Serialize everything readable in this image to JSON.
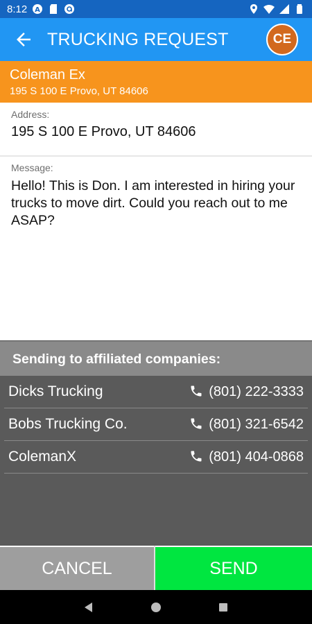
{
  "status_bar": {
    "time": "8:12",
    "left_icons": [
      "a-circle-icon",
      "sd-card-icon",
      "at-circle-icon"
    ],
    "right_icons": [
      "location-icon",
      "wifi-icon",
      "signal-icon",
      "battery-icon"
    ]
  },
  "app_bar": {
    "title": "TRUCKING REQUEST",
    "avatar_initials": "CE"
  },
  "requester": {
    "name": "Coleman Ex",
    "address": "195 S 100 E Provo, UT 84606"
  },
  "address": {
    "label": "Address:",
    "value": "195 S 100 E Provo, UT 84606"
  },
  "message": {
    "label": "Message:",
    "text": "Hello! This is Don. I am interested in hiring your trucks to move dirt. Could you reach out to me ASAP?"
  },
  "affiliates": {
    "header": "Sending to affiliated companies:",
    "companies": [
      {
        "name": "Dicks Trucking",
        "phone": "(801) 222-3333"
      },
      {
        "name": "Bobs Trucking Co.",
        "phone": "(801) 321-6542"
      },
      {
        "name": "ColemanX",
        "phone": "(801) 404-0868"
      }
    ]
  },
  "buttons": {
    "cancel": "CANCEL",
    "send": "SEND"
  },
  "colors": {
    "status_bar": "#1565c0",
    "app_bar": "#2196f3",
    "requester_header": "#f7941d",
    "avatar": "#d2691e",
    "affiliates_header": "#8a8a8a",
    "affiliates_body": "#5a5a5a",
    "cancel_button": "#9e9e9e",
    "send_button": "#00e640"
  },
  "nav_bar": {
    "icons": [
      "back-triangle-icon",
      "home-circle-icon",
      "recents-square-icon"
    ]
  }
}
